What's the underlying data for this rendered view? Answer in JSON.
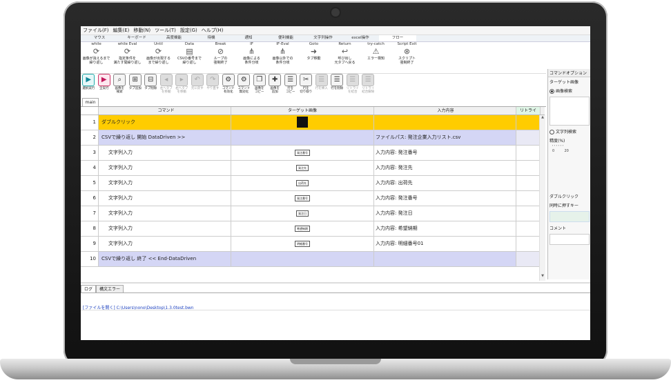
{
  "menu": [
    "ファイル(F)",
    "編集(E)",
    "移動(N)",
    "ツール(T)",
    "設定(G)",
    "ヘルプ(H)"
  ],
  "ribbon_tabs": [
    "マウス",
    "キーボード",
    "高度機能",
    "待機",
    "通知",
    "便利機能",
    "文字列操作",
    "excel操作",
    "フロー"
  ],
  "ribbon_buttons": [
    {
      "top": "while",
      "line1": "画像が消えるまで",
      "line2": "繰り返し",
      "icon": "⟳"
    },
    {
      "top": "while Eval",
      "line1": "指定条件を",
      "line2": "満たす間繰り返し",
      "icon": "⟳"
    },
    {
      "top": "Until",
      "line1": "画像が出現する",
      "line2": "まで繰り返し",
      "icon": "⟳"
    },
    {
      "top": "Data",
      "line1": "CSVの番号まで",
      "line2": "繰り返し",
      "icon": "▤"
    },
    {
      "top": "Break",
      "line1": "ループの",
      "line2": "強制終了",
      "icon": "⊘"
    },
    {
      "top": "IF",
      "line1": "画像による",
      "line2": "条件分岐",
      "icon": "⋔"
    },
    {
      "top": "IF-Eval",
      "line1": "画像以外での",
      "line2": "条件分岐",
      "icon": "⋔"
    },
    {
      "top": "Goto",
      "line1": "タブ移動",
      "line2": "",
      "icon": "➜"
    },
    {
      "top": "Return",
      "line1": "呼び出し",
      "line2": "元タブへ戻る",
      "icon": "↩"
    },
    {
      "top": "try-catch",
      "line1": "エラー検知",
      "line2": "",
      "icon": "⚠"
    },
    {
      "top": "Script Exit",
      "line1": "スクリプト",
      "line2": "強制終了",
      "icon": "⊗"
    }
  ],
  "toolbar": [
    {
      "label1": "選択実行",
      "label2": "",
      "icon": "▶",
      "style": "play"
    },
    {
      "label1": "全実行",
      "label2": "",
      "icon": "▶",
      "style": "stop"
    },
    {
      "label1": "画像を",
      "label2": "検索",
      "icon": "⌕",
      "style": ""
    },
    {
      "label1": "タブ追加",
      "label2": "",
      "icon": "⊞",
      "style": ""
    },
    {
      "label1": "タブ削除",
      "label2": "",
      "icon": "⊟",
      "style": ""
    },
    {
      "label1": "左へタブ",
      "label2": "を移動",
      "icon": "◂",
      "style": "dis"
    },
    {
      "label1": "右へタブ",
      "label2": "を移動",
      "icon": "▸",
      "style": "dis"
    },
    {
      "label1": "元に戻す",
      "label2": "",
      "icon": "↶",
      "style": "dis"
    },
    {
      "label1": "やり直す",
      "label2": "",
      "icon": "↷",
      "style": "dis"
    },
    {
      "label1": "コマンド",
      "label2": "有効化",
      "icon": "⚙",
      "style": ""
    },
    {
      "label1": "コマンド",
      "label2": "無効化",
      "icon": "⚙",
      "style": ""
    },
    {
      "label1": "画像を",
      "label2": "コピー",
      "icon": "❐",
      "style": ""
    },
    {
      "label1": "画像を",
      "label2": "追加",
      "icon": "✚",
      "style": ""
    },
    {
      "label1": "行を",
      "label2": "コピー",
      "icon": "☰",
      "style": ""
    },
    {
      "label1": "行を",
      "label2": "切り取り",
      "icon": "✂",
      "style": ""
    },
    {
      "label1": "行を挿入",
      "label2": "",
      "icon": "☰",
      "style": "dis"
    },
    {
      "label1": "行を削除",
      "label2": "",
      "icon": "☰",
      "style": ""
    },
    {
      "label1": "リトライ",
      "label2": "を結合",
      "icon": "☰",
      "style": "dis"
    },
    {
      "label1": "リトライ",
      "label2": "結合解除",
      "icon": "☰",
      "style": "dis"
    }
  ],
  "tab_main": "main",
  "grid": {
    "headers": [
      "",
      "コマンド",
      "ターゲット画像",
      "入力内容",
      "リトライ"
    ],
    "rows": [
      {
        "no": "1",
        "cmd": "ダブルクリック",
        "img": "",
        "img_dark": true,
        "input": "",
        "style": "yellow",
        "indent": false
      },
      {
        "no": "2",
        "cmd": "CSVで繰り返し 開始 DataDriven >>",
        "img": "",
        "img_dark": false,
        "input": "ファイルパス: 発注企業入力リスト.csv",
        "style": "lav",
        "indent": false
      },
      {
        "no": "3",
        "cmd": "文字列入力",
        "img": "発注番号",
        "img_dark": false,
        "input": "入力内容: 発注番号",
        "style": "",
        "indent": true
      },
      {
        "no": "4",
        "cmd": "文字列入力",
        "img": "発注先",
        "img_dark": false,
        "input": "入力内容: 発注先",
        "style": "",
        "indent": true
      },
      {
        "no": "5",
        "cmd": "文字列入力",
        "img": "出荷先",
        "img_dark": false,
        "input": "入力内容: 出荷先",
        "style": "",
        "indent": true
      },
      {
        "no": "6",
        "cmd": "文字列入力",
        "img": "発注番号",
        "img_dark": false,
        "input": "入力内容: 発注番号",
        "style": "",
        "indent": true
      },
      {
        "no": "7",
        "cmd": "文字列入力",
        "img": "発注日",
        "img_dark": false,
        "input": "入力内容: 発注日",
        "style": "",
        "indent": true
      },
      {
        "no": "8",
        "cmd": "文字列入力",
        "img": "希望納期",
        "img_dark": false,
        "input": "入力内容: 希望納期",
        "style": "",
        "indent": true
      },
      {
        "no": "9",
        "cmd": "文字列入力",
        "img": "明細番号",
        "img_dark": false,
        "input": "入力内容: 明細番号01",
        "style": "",
        "indent": true
      },
      {
        "no": "10",
        "cmd": "CSVで繰り返し 終了 << End-DataDriven",
        "img": "",
        "img_dark": false,
        "input": "",
        "style": "lav",
        "indent": false
      }
    ]
  },
  "log_tabs": [
    "ログ",
    "構文エラー"
  ],
  "log_line": "[ファイルを開く] C:\\Users\\nono\\Desktop\\1.3.0test.bwn",
  "options": {
    "title": "コマンドオプション",
    "target_label": "ターゲット画像",
    "radio_image": "画像検索",
    "radio_text": "文字列検索",
    "accuracy": "精度(%)",
    "tick0": "0",
    "tick20": "20",
    "double_click": "ダブルクリック",
    "simul_key": "同時に押すキー",
    "comment": "コメント"
  }
}
